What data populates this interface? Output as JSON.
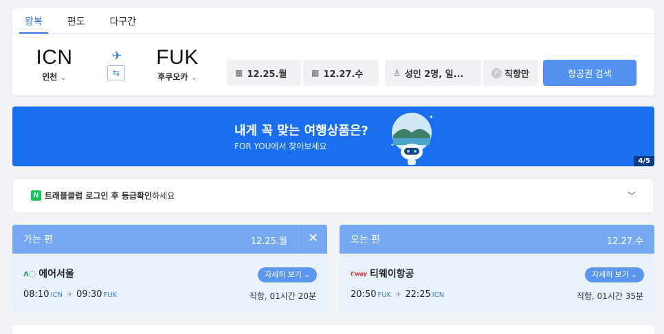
{
  "tabs": [
    "왕복",
    "편도",
    "다구간"
  ],
  "route": {
    "dep": {
      "code": "ICN",
      "city": "인천"
    },
    "arr": {
      "code": "FUK",
      "city": "후쿠오카"
    }
  },
  "search": {
    "date_out": "12.25.월",
    "date_in": "12.27.수",
    "passengers": "성인 2명, 일...",
    "direct_only": "직항만",
    "button": "항공권 검색"
  },
  "banner": {
    "title": "내게 꼭 맞는 여행상품은?",
    "subtitle": "FOR YOU에서 찾아보세요",
    "page": "4/5"
  },
  "notice": {
    "badge": "N",
    "text_bold": "트래블클럽 로그인 후 등급확인",
    "text_rest": " 하세요"
  },
  "outbound": {
    "header": "가는 편",
    "date": "12.25.월",
    "airline": "에어서울",
    "detail_button": "자세히 보기",
    "dep_time": "08:10",
    "dep_airport": "ICN",
    "arr_time": "09:30",
    "arr_airport": "FUK",
    "duration": "직항, 01시간 20분"
  },
  "inbound": {
    "header": "오는 편",
    "date": "12.27.수",
    "airline": "티웨이항공",
    "airline_logo": "t'way",
    "detail_button": "자세히 보기",
    "dep_time": "20:50",
    "dep_airport": "FUK",
    "arr_time": "22:25",
    "arr_airport": "ICN",
    "duration": "직항, 01시간 35분"
  }
}
